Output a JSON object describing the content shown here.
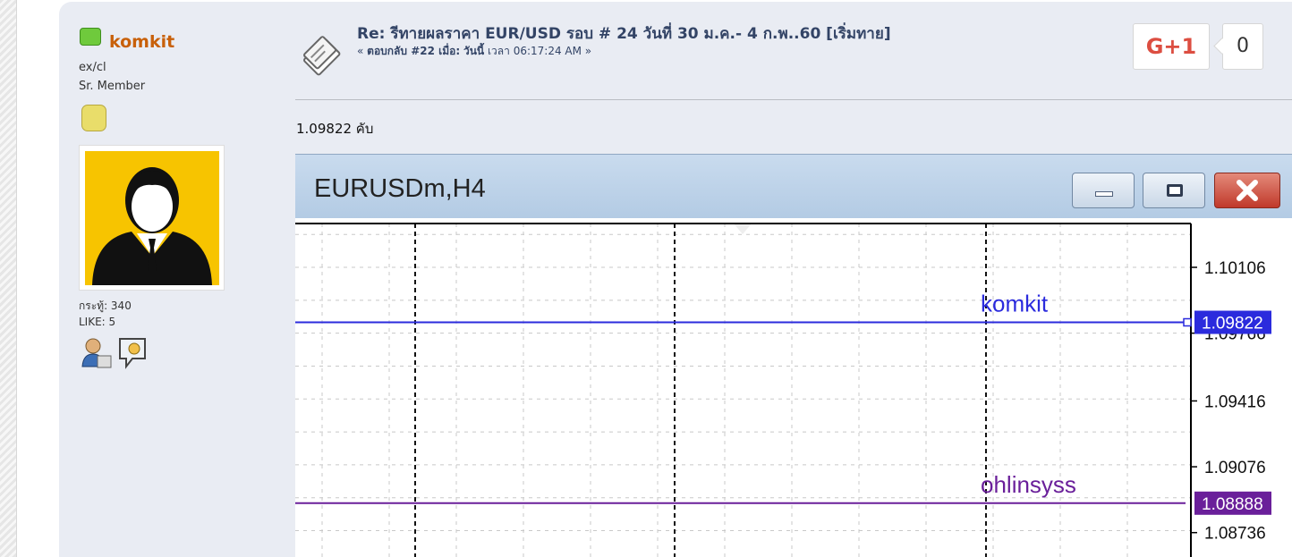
{
  "poster": {
    "username": "komkit",
    "custom_title": "ex/cl",
    "rank": "Sr. Member",
    "posts": "กระทู้: 340",
    "likes": "LIKE: 5",
    "icons": [
      "profile-icon",
      "message-icon"
    ]
  },
  "post": {
    "title": "Re: รีทายผลราคา EUR/USD รอบ # 24 วันที่ 30 ม.ค.- 4 ก.พ..60 [เริ่มทาย]",
    "reply_prefix": "« ",
    "reply_label": "ตอบกลับ #22 เมื่อ:",
    "reply_day": "วันนี้",
    "reply_time": "เวลา 06:17:24 AM »",
    "body": "1.09822 คับ"
  },
  "gplus": {
    "label": "G+1",
    "count": "0",
    "color": "#dc4e41"
  },
  "chart_window": {
    "title": "EURUSDm,H4"
  },
  "chart_data": {
    "type": "line",
    "title": "EURUSDm,H4",
    "y_ticks": [
      1.10106,
      1.09766,
      1.09416,
      1.09076,
      1.08736
    ],
    "ylim": [
      1.0861,
      1.1036
    ],
    "grid": true,
    "horizontal_lines": [
      {
        "label": "komkit",
        "value": 1.09822,
        "value_label": "1.09822",
        "color": "#2b2bdd"
      },
      {
        "label": "ohlinsyss",
        "value": 1.08888,
        "value_label": "1.08888",
        "color": "#6a1f9a"
      }
    ]
  }
}
